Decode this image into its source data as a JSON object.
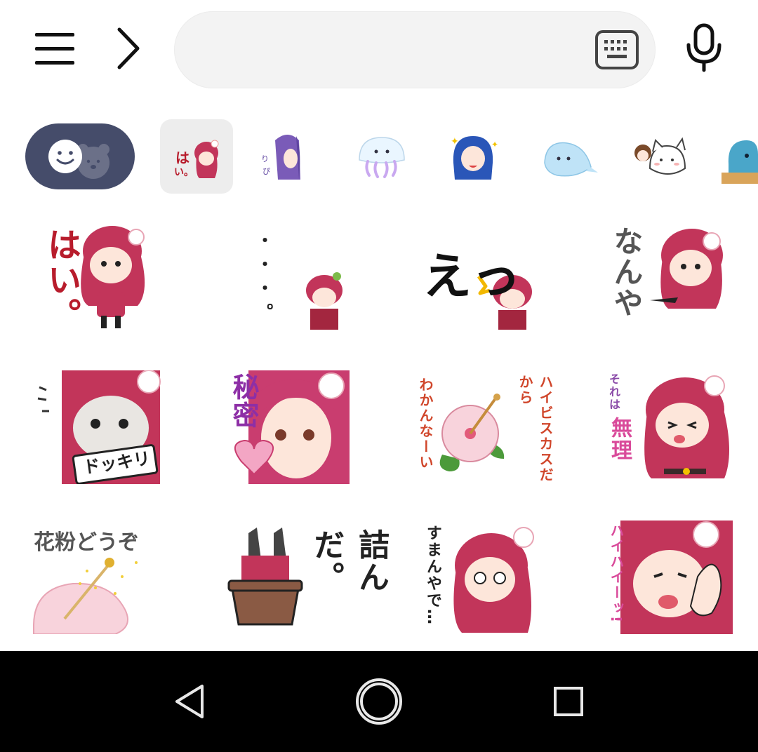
{
  "toolbar": {
    "menu_icon": "hamburger-menu-icon",
    "forward_icon": "chevron-right-icon",
    "search_value": "",
    "keyboard_icon": "keyboard-icon",
    "mic_icon": "microphone-icon"
  },
  "packs": [
    {
      "icon": "emoji-smiley-bear-icon",
      "selected": false
    },
    {
      "icon": "pink-hair-girl-pack-thumbnail",
      "selected": true
    },
    {
      "icon": "purple-hair-girl-pack-thumbnail",
      "selected": false
    },
    {
      "icon": "jellyfish-pack-thumbnail",
      "selected": false
    },
    {
      "icon": "blue-hair-girl-pack-thumbnail",
      "selected": false
    },
    {
      "icon": "dolphin-pack-thumbnail",
      "selected": false
    },
    {
      "icon": "cat-pack-thumbnail",
      "selected": false
    },
    {
      "icon": "seal-pack-thumbnail",
      "selected": false
    }
  ],
  "stickers": [
    {
      "text": "はい。"
    },
    {
      "text": "・・・。"
    },
    {
      "text": "えっ"
    },
    {
      "text": "なんや"
    },
    {
      "text": "ドッキリ"
    },
    {
      "text": "秘密"
    },
    {
      "text": "ハイビスカスだからわかんなーい",
      "text_a": "ハイビスカスだから",
      "text_b": "わかんなーい"
    },
    {
      "text": "それは無理",
      "text_a": "それは",
      "text_b": "無理"
    },
    {
      "text": "花粉どうぞ"
    },
    {
      "text": "詰んだ。"
    },
    {
      "text": "すまんやで…"
    },
    {
      "text": "ハイハイーッ!"
    }
  ],
  "colors": {
    "accent_dark": "#454c6a",
    "hair_pink": "#c2355a",
    "text_red": "#b81c2c",
    "nav_bg": "#000000"
  },
  "navbar": {
    "back_icon": "back-triangle-icon",
    "home_icon": "home-circle-icon",
    "recents_icon": "recents-square-icon"
  }
}
